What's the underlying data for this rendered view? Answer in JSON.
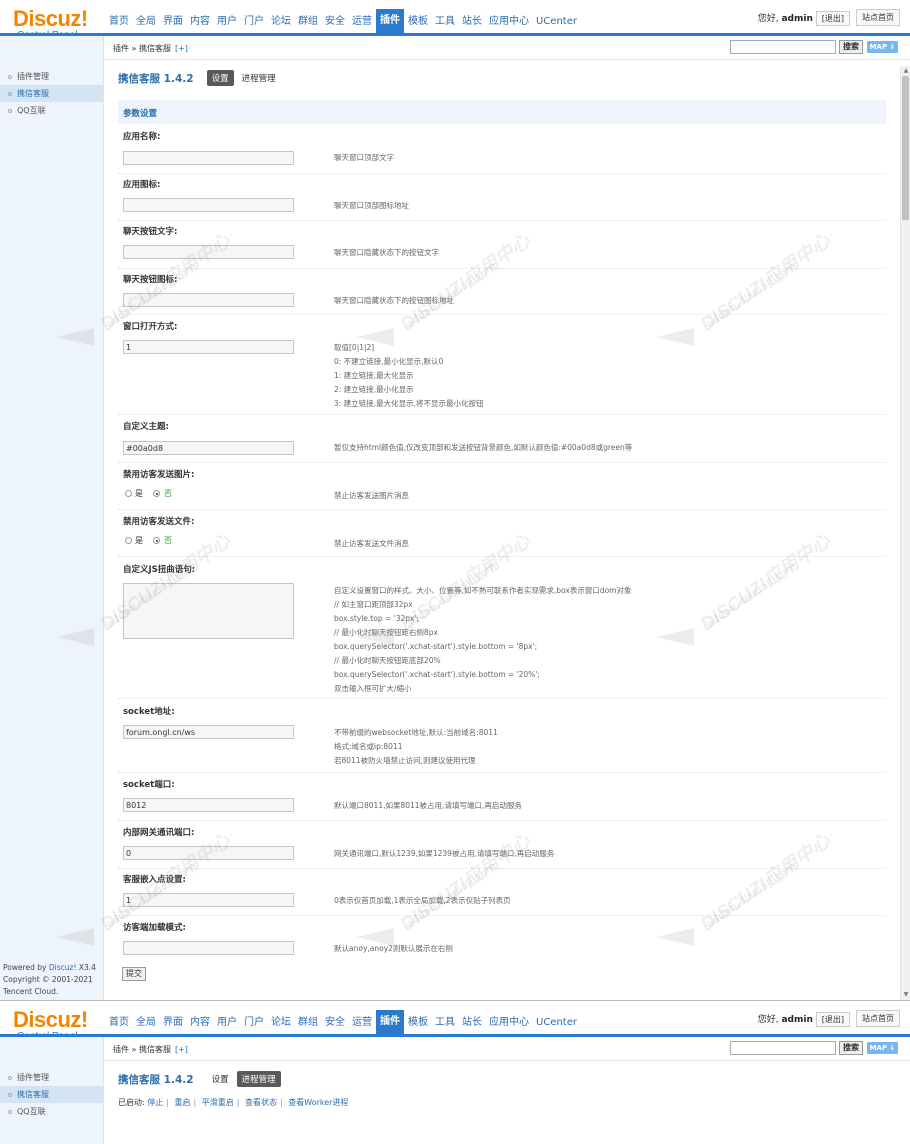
{
  "logo": {
    "brand": "Discuz!",
    "sub": "Control Panel"
  },
  "nav": [
    {
      "label": "首页",
      "active": false
    },
    {
      "label": "全局",
      "active": false
    },
    {
      "label": "界面",
      "active": false
    },
    {
      "label": "内容",
      "active": false
    },
    {
      "label": "用户",
      "active": false
    },
    {
      "label": "门户",
      "active": false
    },
    {
      "label": "论坛",
      "active": false
    },
    {
      "label": "群组",
      "active": false
    },
    {
      "label": "安全",
      "active": false
    },
    {
      "label": "运营",
      "active": false
    },
    {
      "label": "插件",
      "active": true
    },
    {
      "label": "模板",
      "active": false
    },
    {
      "label": "工具",
      "active": false
    },
    {
      "label": "站长",
      "active": false
    },
    {
      "label": "应用中心",
      "active": false
    },
    {
      "label": "UCenter",
      "active": false
    }
  ],
  "header": {
    "greeting": "您好,",
    "username": "admin",
    "logout": "[退出]",
    "site_home": "站点首页"
  },
  "breadcrumb": {
    "text": "插件 » 携信客服",
    "plus": "[+]"
  },
  "search": {
    "button": "搜索",
    "map": "MAP ⇓"
  },
  "sidebar": {
    "items": [
      {
        "label": "插件管理",
        "active": false
      },
      {
        "label": "携信客服",
        "active": true
      },
      {
        "label": "QQ互联",
        "active": false
      }
    ]
  },
  "footer": {
    "powered_prefix": "Powered by ",
    "powered_link": "Discuz!",
    "version": " X3.4",
    "copyright": "Copyright © 2001-2021",
    "company": "Tencent Cloud."
  },
  "plugin": {
    "title": "携信客服 1.4.2",
    "tab_settings": "设置",
    "tab_process": "进程管理"
  },
  "section_title": "参数设置",
  "fields": [
    {
      "label": "应用名称:",
      "value": "",
      "desc": [
        "聊天窗口顶部文字"
      ]
    },
    {
      "label": "应用图标:",
      "value": "",
      "desc": [
        "聊天窗口顶部图标地址"
      ]
    },
    {
      "label": "聊天按钮文字:",
      "value": "",
      "desc": [
        "聊天窗口隐藏状态下的按钮文字"
      ]
    },
    {
      "label": "聊天按钮图标:",
      "value": "",
      "desc": [
        "聊天窗口隐藏状态下的按钮图标地址"
      ]
    },
    {
      "label": "窗口打开方式:",
      "value": "1",
      "desc": [
        "取值[0|1|2]",
        "0: 不建立链接,最小化显示,默认0",
        "1: 建立链接,最大化显示",
        "2: 建立链接,最小化显示",
        "3: 建立链接,最大化显示,将不显示最小化按钮"
      ]
    },
    {
      "label": "自定义主题:",
      "value": "#00a0d8",
      "desc": [
        "暂仅支持html颜色值,仅改变顶部和发送按钮背景颜色,如默认颜色值:#00a0d8或green等"
      ]
    },
    {
      "label": "禁用访客发送图片:",
      "radio": {
        "yes": "是",
        "no": "否"
      },
      "desc": [
        "禁止访客发送图片消息"
      ]
    },
    {
      "label": "禁用访客发送文件:",
      "radio": {
        "yes": "是",
        "no": "否"
      },
      "desc": [
        "禁止访客发送文件消息"
      ]
    },
    {
      "label": "自定义JS扭曲语句:",
      "textarea": true,
      "desc": [
        "自定义设置窗口的样式、大小、位置等,如不熟可联系作者实现需求,box表示窗口dom对象",
        "// 如主窗口距顶部32px",
        "box.style.top = '32px';",
        "// 最小化时聊天按钮距右侧8px",
        "box.querySelector('.xchat-start').style.bottom = '8px';",
        "// 最小化时聊天按钮距底部20%",
        "box.querySelector('.xchat-start').style.bottom = '20%';",
        "双击输入框可扩大/缩小"
      ]
    },
    {
      "label": "socket地址:",
      "value": "forum.ongl.cn/ws",
      "desc": [
        "不带前缀的websocket地址,默认:当前域名:8011",
        "格式:域名或ip:8011",
        "若8011被防火墙禁止访问,则建议使用代理"
      ]
    },
    {
      "label": "socket端口:",
      "value": "8012",
      "desc": [
        "默认端口8011,如果8011被占用,请填写端口,再启动服务"
      ]
    },
    {
      "label": "内部网关通讯端口:",
      "value": "0",
      "desc": [
        "网关通讯端口,默认1239,如果1239被占用,请填写端口,再启动服务"
      ]
    },
    {
      "label": "客服嵌入点设置:",
      "value": "1",
      "desc": [
        "0表示仅首页加载,1表示全局加载,2表示仅贴子列表页"
      ]
    },
    {
      "label": "访客端加载模式:",
      "value": "",
      "desc": [
        "默认anoy,anoy2则默认展示在右侧"
      ]
    }
  ],
  "submit": "提交",
  "watermark": {
    "brand": "DISCUZ!应用中心",
    "domain": "addon.dismall.com",
    "mark": "贰道"
  },
  "status": {
    "prefix": "已启动:",
    "links": [
      "停止",
      "重启",
      "平滑重启",
      "查看状态",
      "查看Worker进程"
    ]
  }
}
